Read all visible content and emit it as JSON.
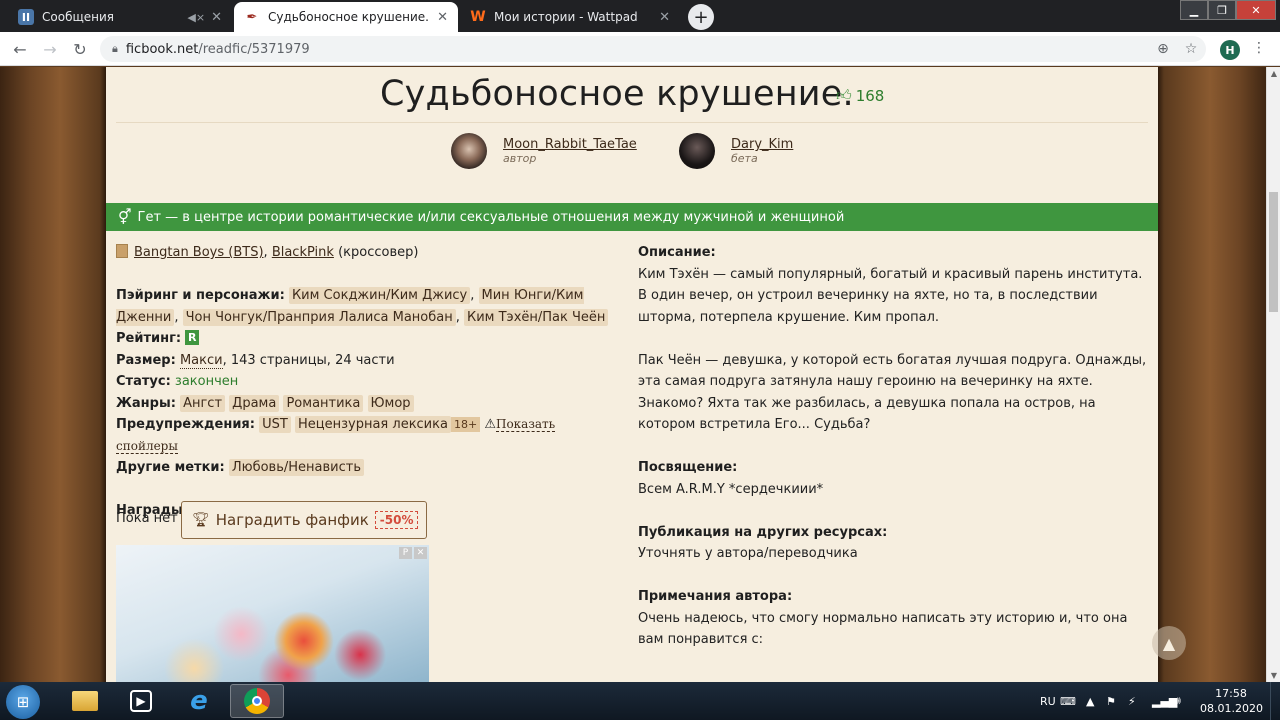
{
  "browser": {
    "tabs": [
      {
        "title": "Сообщения",
        "favicon": "vk-icon",
        "active": false
      },
      {
        "title": "Судьбоносное крушение. — фа",
        "favicon": "ficbook-quill-icon",
        "active": true
      },
      {
        "title": "Мои истории - Wattpad",
        "favicon": "wattpad-icon",
        "active": false
      }
    ],
    "url_host": "ficbook.net",
    "url_path": "/readfic/5371979",
    "profile_initial": "H"
  },
  "fic": {
    "title": "Судьбоносное крушение.",
    "likes": "168",
    "author": {
      "name": "Moon_Rabbit_TaeTae",
      "role": "автор"
    },
    "beta": {
      "name": "Dary_Kim",
      "role": "бета"
    },
    "direction": "Гет — в центре истории романтические и/или сексуальные отношения между мужчиной и женщиной",
    "fandom1": "Bangtan Boys (BTS)",
    "fandom2": "BlackPink",
    "crossover": "(кроссовер)",
    "pairings_label": "Пэйринг и персонажи:",
    "pairings": [
      "Ким Сокджин/Ким Джису",
      "Мин Юнги/Ким Дженни",
      "Чон Чонгук/Пранприя Лалиса Манобан",
      "Ким Тэхён/Пак Чеён"
    ],
    "rating_label": "Рейтинг:",
    "rating": "R",
    "size_label": "Размер:",
    "size_link": "Макси",
    "size_rest": ", 143 страницы, 24 части",
    "status_label": "Статус:",
    "status": "закончен",
    "genres_label": "Жанры:",
    "genres": [
      "Ангст",
      "Драма",
      "Романтика",
      "Юмор"
    ],
    "warnings_label": "Предупреждения:",
    "warnings": [
      "UST",
      "Нецензурная лексика"
    ],
    "warning_age": "18+",
    "show_spoilers": "Показать спойлеры",
    "other_tags_label": "Другие метки:",
    "other_tags": [
      "Любовь/Ненависть"
    ],
    "awards_label": "Награды от читателей:",
    "awards_none": "Пока нет",
    "award_button": "Наградить фанфик",
    "award_discount": "-50%",
    "description_label": "Описание:",
    "description_p1": "Ким Тэхён — самый популярный, богатый и красивый парень института. В один вечер, он устроил вечеринку на яхте, но та, в последствии шторма, потерпела крушение. Ким пропал.",
    "description_p2": "Пак Чеён — девушка, у которой есть богатая лучшая подруга. Однажды, эта самая подруга затянула нашу героиню на вечеринку на яхте. Знакомо? Яхта так же разбилась, а девушка попала на остров, на котором встретила Его... Судьба?",
    "dedication_label": "Посвящение:",
    "dedication": "Всем A.R.M.Y *сердечкиии*",
    "publication_label": "Публикация на других ресурсах:",
    "publication": "Уточнять у автора/переводчика",
    "notes_label": "Примечания автора:",
    "notes": "Очень надеюсь, что смогу нормально написать эту историю и, что она вам понравится с:"
  },
  "ad": {
    "badge_p": "P",
    "badge_x": "✕"
  },
  "taskbar": {
    "lang": "RU",
    "time": "17:58",
    "date": "08.01.2020"
  },
  "colors": {
    "accent_green": "#3f963f",
    "paper": "#f6eedf",
    "tag_bg": "#ead9be"
  }
}
